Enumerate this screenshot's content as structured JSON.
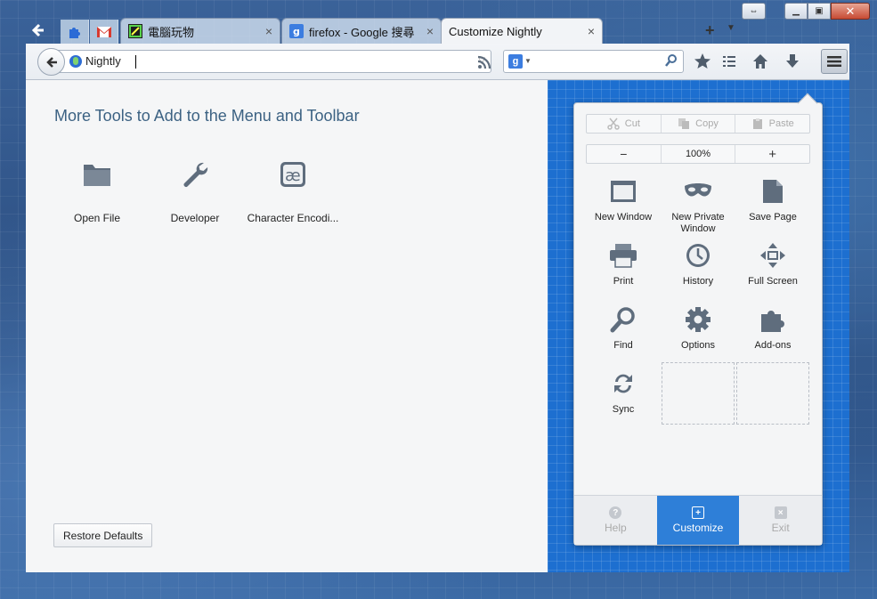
{
  "window": {
    "caption": {
      "restore_glyph": "⇔",
      "min_glyph": "▁",
      "max_glyph": "▣",
      "close_glyph": "✕"
    }
  },
  "tabs": [
    {
      "label": "電腦玩物",
      "close": "×",
      "favicon": "computer-toys-icon"
    },
    {
      "label": "firefox - Google 搜尋",
      "close": "×",
      "favicon": "google-icon"
    },
    {
      "label": "Customize Nightly",
      "close": "×",
      "favicon": "",
      "active": true
    }
  ],
  "tabstrip": {
    "new_tab": "+",
    "all_tabs": "▼"
  },
  "navbar": {
    "url_identity": "Nightly",
    "url_value": "",
    "search_engine_letter": "g"
  },
  "palette": {
    "title": "More Tools to Add to the Menu and Toolbar",
    "items": [
      {
        "label": "Open File",
        "icon": "folder-icon"
      },
      {
        "label": "Developer",
        "icon": "wrench-icon"
      },
      {
        "label": "Character Encodi...",
        "icon": "character-encoding-icon",
        "glyph": "æ"
      }
    ],
    "restore_label": "Restore Defaults"
  },
  "panel": {
    "edit": {
      "cut": "Cut",
      "copy": "Copy",
      "paste": "Paste"
    },
    "zoom": {
      "minus": "−",
      "value": "100%",
      "plus": "+"
    },
    "items": [
      {
        "label": "New Window",
        "icon": "new-window-icon"
      },
      {
        "label": "New Private Window",
        "icon": "private-mask-icon"
      },
      {
        "label": "Save Page",
        "icon": "save-page-icon"
      },
      {
        "label": "Print",
        "icon": "printer-icon"
      },
      {
        "label": "History",
        "icon": "clock-icon"
      },
      {
        "label": "Full Screen",
        "icon": "fullscreen-icon"
      },
      {
        "label": "Find",
        "icon": "magnifier-icon"
      },
      {
        "label": "Options",
        "icon": "gear-icon"
      },
      {
        "label": "Add-ons",
        "icon": "puzzle-icon"
      },
      {
        "label": "Sync",
        "icon": "sync-icon"
      }
    ],
    "footer": {
      "help": "Help",
      "help_glyph": "?",
      "customize": "Customize",
      "customize_glyph": "+",
      "exit": "Exit",
      "exit_glyph": "×"
    }
  },
  "colors": {
    "accent": "#2e7fd8",
    "blueprint": "#1d6fd0",
    "palette_title": "#3c6283",
    "icon_gray": "#5f6d7d"
  }
}
